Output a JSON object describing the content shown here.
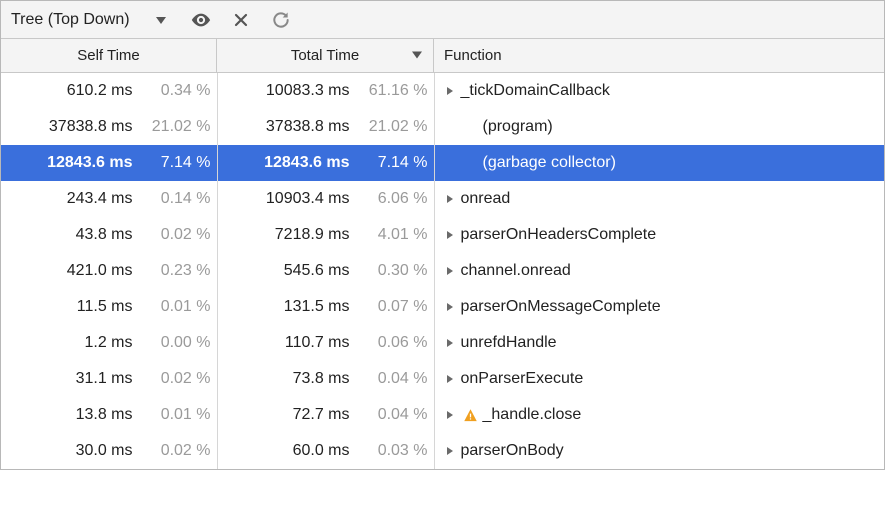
{
  "toolbar": {
    "title": "Tree (Top Down)"
  },
  "columns": {
    "self": "Self Time",
    "total": "Total Time",
    "fn": "Function"
  },
  "rows": [
    {
      "self_ms": "610.2 ms",
      "self_pct": "0.34 %",
      "self_warn": false,
      "total_ms": "10083.3 ms",
      "total_pct": "61.16 %",
      "fn": "_tickDomainCallback",
      "expandable": true,
      "indent": false,
      "warning": false,
      "selected": false
    },
    {
      "self_ms": "37838.8 ms",
      "self_pct": "21.02 %",
      "self_warn": false,
      "total_ms": "37838.8 ms",
      "total_pct": "21.02 %",
      "fn": "(program)",
      "expandable": false,
      "indent": true,
      "warning": false,
      "selected": false
    },
    {
      "self_ms": "12843.6 ms",
      "self_pct": "7.14 %",
      "self_warn": true,
      "total_ms": "12843.6 ms",
      "total_pct": "7.14 %",
      "fn": "(garbage collector)",
      "expandable": false,
      "indent": true,
      "warning": false,
      "selected": true
    },
    {
      "self_ms": "243.4 ms",
      "self_pct": "0.14 %",
      "self_warn": false,
      "total_ms": "10903.4 ms",
      "total_pct": "6.06 %",
      "fn": "onread",
      "expandable": true,
      "indent": false,
      "warning": false,
      "selected": false
    },
    {
      "self_ms": "43.8 ms",
      "self_pct": "0.02 %",
      "self_warn": false,
      "total_ms": "7218.9 ms",
      "total_pct": "4.01 %",
      "fn": "parserOnHeadersComplete",
      "expandable": true,
      "indent": false,
      "warning": false,
      "selected": false
    },
    {
      "self_ms": "421.0 ms",
      "self_pct": "0.23 %",
      "self_warn": false,
      "total_ms": "545.6 ms",
      "total_pct": "0.30 %",
      "fn": "channel.onread",
      "expandable": true,
      "indent": false,
      "warning": false,
      "selected": false
    },
    {
      "self_ms": "11.5 ms",
      "self_pct": "0.01 %",
      "self_warn": false,
      "total_ms": "131.5 ms",
      "total_pct": "0.07 %",
      "fn": "parserOnMessageComplete",
      "expandable": true,
      "indent": false,
      "warning": false,
      "selected": false
    },
    {
      "self_ms": "1.2 ms",
      "self_pct": "0.00 %",
      "self_warn": false,
      "total_ms": "110.7 ms",
      "total_pct": "0.06 %",
      "fn": "unrefdHandle",
      "expandable": true,
      "indent": false,
      "warning": false,
      "selected": false
    },
    {
      "self_ms": "31.1 ms",
      "self_pct": "0.02 %",
      "self_warn": false,
      "total_ms": "73.8 ms",
      "total_pct": "0.04 %",
      "fn": "onParserExecute",
      "expandable": true,
      "indent": false,
      "warning": false,
      "selected": false
    },
    {
      "self_ms": "13.8 ms",
      "self_pct": "0.01 %",
      "self_warn": false,
      "total_ms": "72.7 ms",
      "total_pct": "0.04 %",
      "fn": "_handle.close",
      "expandable": true,
      "indent": false,
      "warning": true,
      "selected": false
    },
    {
      "self_ms": "30.0 ms",
      "self_pct": "0.02 %",
      "self_warn": false,
      "total_ms": "60.0 ms",
      "total_pct": "0.03 %",
      "fn": "parserOnBody",
      "expandable": true,
      "indent": false,
      "warning": false,
      "selected": false
    }
  ]
}
